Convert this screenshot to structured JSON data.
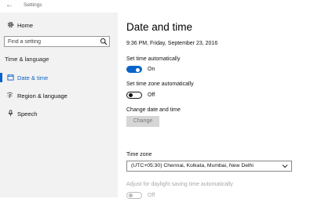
{
  "window": {
    "title": "Settings"
  },
  "sidebar": {
    "home_label": "Home",
    "search": {
      "placeholder": "Find a setting"
    },
    "section_header": "Time & language",
    "items": [
      {
        "label": "Date & time",
        "icon": "clock-icon",
        "active": true
      },
      {
        "label": "Region & language",
        "icon": "globe-language-icon",
        "active": false
      },
      {
        "label": "Speech",
        "icon": "microphone-icon",
        "active": false
      }
    ]
  },
  "main": {
    "title": "Date and time",
    "current_datetime": "9:36 PM, Friday, September 23, 2016",
    "set_time_auto": {
      "label": "Set time automatically",
      "state": "On"
    },
    "set_timezone_auto": {
      "label": "Set time zone automatically",
      "state": "Off"
    },
    "change_date_time": {
      "label": "Change date and time",
      "button_label": "Change"
    },
    "time_zone": {
      "label": "Time zone",
      "selected": "(UTC+05:30) Chennai, Kolkata, Mumbai, New Delhi"
    },
    "daylight_saving": {
      "label": "Adjust for daylight saving time automatically",
      "state": "Off"
    }
  },
  "colors": {
    "accent": "#0a63c9",
    "sidebar_bg": "#f2f2f2",
    "disabled": "#a8a8a8"
  }
}
